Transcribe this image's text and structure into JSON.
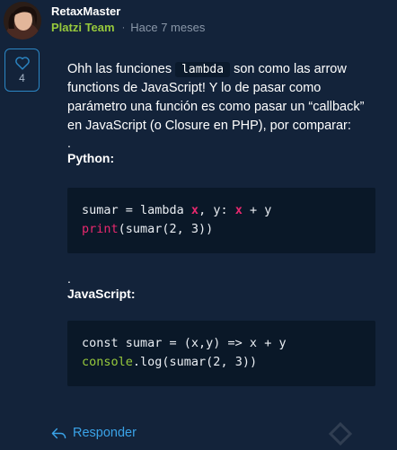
{
  "comment": {
    "author": "RetaxMaster",
    "team": "Platzi Team",
    "separator": "·",
    "time": "Hace 7 meses",
    "likes": "4",
    "intro_before": "Ohh las funciones ",
    "intro_code": "lambda",
    "intro_after": " son como las arrow functions de JavaScript! Y lo de pasar como parámetro una función es como pasar un “callback” en JavaScript (o Closure en PHP), por comparar:",
    "dot1": ".",
    "python_label": "Python:",
    "python_line1": {
      "a": "sumar = lambda ",
      "x1": "x",
      "b": ", y: ",
      "x2": "x",
      "c": " + y"
    },
    "python_line2": {
      "fn": "print",
      "rest": "(sumar(2, 3))"
    },
    "dot2": ".",
    "js_label": "JavaScript:",
    "js_line1": "const sumar = (x,y) => x + y",
    "js_line2": {
      "fn": "console",
      "rest": ".log(sumar(2, 3))"
    },
    "reply_label": "Responder"
  },
  "icons": {
    "like": "heart-icon",
    "reply": "reply-arrow-icon"
  },
  "colors": {
    "background": "#13233a",
    "team": "#97c93c",
    "accent": "#3aa3e8",
    "keyword": "#e8286e",
    "code_bg": "#0a1828"
  }
}
